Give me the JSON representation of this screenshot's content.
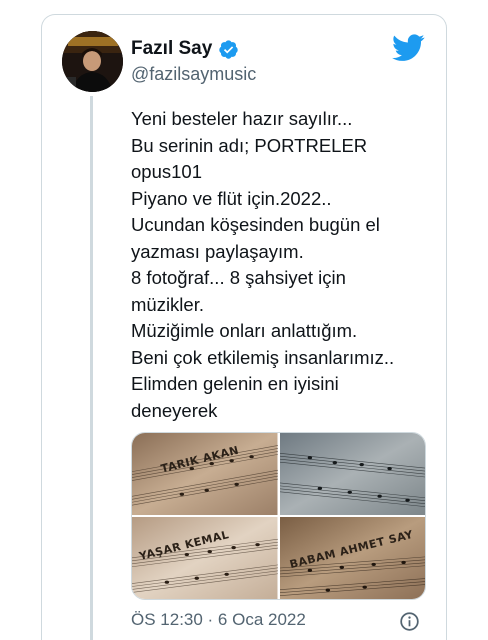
{
  "user": {
    "display_name": "Fazıl Say",
    "handle": "@fazilsaymusic",
    "verified": true
  },
  "tweet": {
    "lines": [
      "Yeni besteler hazır sayılır...",
      "Bu serinin adı; PORTRELER",
      "opus101",
      "Piyano ve flüt için.2022..",
      "Ucundan köşesinden bugün el",
      "yazması paylaşayım.",
      "8 fotoğraf... 8 şahsiyet için",
      "müzikler.",
      "Müziğimle onları anlattığım.",
      "Beni çok etkilemiş insanlarımız..",
      "Elimden gelenin en iyisini",
      "deneyerek"
    ],
    "timestamp": "ÖS 12:30 · 6 Oca 2022"
  },
  "media": {
    "photos": [
      {
        "caption": "TARIK AKAN"
      },
      {
        "caption": ""
      },
      {
        "caption": "YAŞAR KEMAL"
      },
      {
        "caption": "BABAM AHMET SAY"
      }
    ]
  },
  "colors": {
    "brand_blue": "#1d9bf0",
    "muted_text": "#536471",
    "border": "#cfd9de"
  },
  "icons": {
    "verified": "verified-badge-icon",
    "logo": "twitter-bird-icon",
    "info": "info-icon"
  }
}
